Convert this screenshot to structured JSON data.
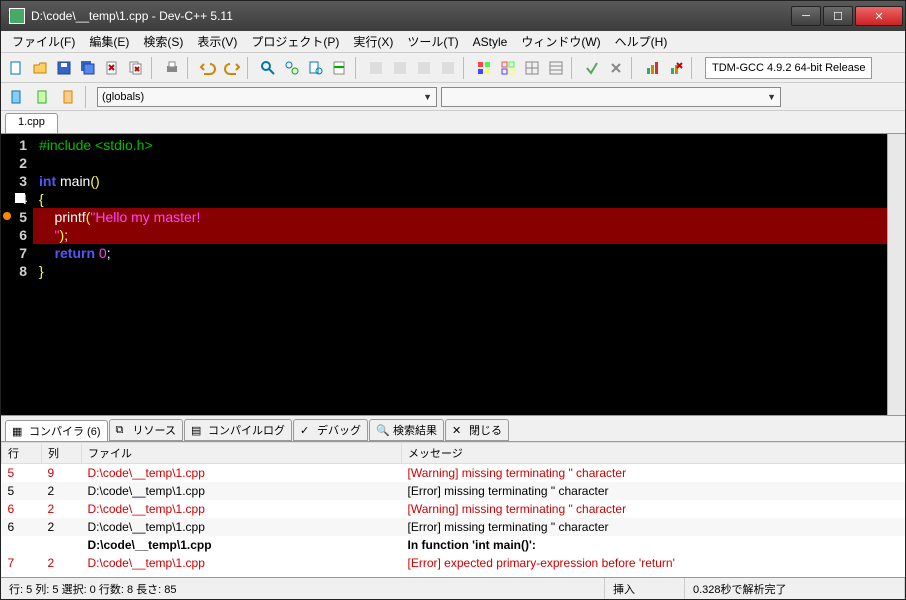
{
  "window": {
    "title": "D:\\code\\__temp\\1.cpp - Dev-C++ 5.11"
  },
  "menus": [
    "ファイル(F)",
    "編集(E)",
    "検索(S)",
    "表示(V)",
    "プロジェクト(P)",
    "実行(X)",
    "ツール(T)",
    "AStyle",
    "ウィンドウ(W)",
    "ヘルプ(H)"
  ],
  "compiler_selector": "TDM-GCC 4.9.2 64-bit Release",
  "scope_dd": "(globals)",
  "member_dd": "",
  "file_tab": "1.cpp",
  "code": {
    "lines": [
      {
        "n": 1,
        "seg": [
          {
            "t": "#include <stdio.h>",
            "c": "c-pre"
          }
        ]
      },
      {
        "n": 2,
        "seg": []
      },
      {
        "n": 3,
        "seg": [
          {
            "t": "int",
            "c": "c-kw"
          },
          {
            "t": " main",
            "c": "c-fn"
          },
          {
            "t": "()",
            "c": "c-br"
          }
        ]
      },
      {
        "n": 4,
        "cur": true,
        "seg": [
          {
            "t": "{",
            "c": "c-br"
          }
        ]
      },
      {
        "n": 5,
        "bp": true,
        "hl": true,
        "seg": [
          {
            "t": "    printf",
            "c": "c-fn"
          },
          {
            "t": "(",
            "c": "c-br"
          },
          {
            "t": "\"Hello my master!",
            "c": "c-str"
          }
        ]
      },
      {
        "n": 6,
        "hl": true,
        "seg": [
          {
            "t": "    \"",
            "c": "c-str"
          },
          {
            "t": ")",
            "c": "c-br"
          },
          {
            "t": ";",
            "c": "c-pl"
          }
        ]
      },
      {
        "n": 7,
        "seg": [
          {
            "t": "    ",
            "c": "c-pl"
          },
          {
            "t": "return",
            "c": "c-kw"
          },
          {
            "t": " ",
            "c": "c-pl"
          },
          {
            "t": "0",
            "c": "c-num"
          },
          {
            "t": ";",
            "c": "c-pl"
          }
        ]
      },
      {
        "n": 8,
        "seg": [
          {
            "t": "}",
            "c": "c-br"
          }
        ]
      }
    ]
  },
  "bottom_tabs": [
    {
      "label": "コンパイラ (6)",
      "active": true
    },
    {
      "label": "リソース"
    },
    {
      "label": "コンパイルログ"
    },
    {
      "label": "デバッグ"
    },
    {
      "label": "検索結果"
    },
    {
      "label": "閉じる"
    }
  ],
  "msg_headers": {
    "line": "行",
    "col": "列",
    "file": "ファイル",
    "msg": "メッセージ"
  },
  "messages": [
    {
      "line": "5",
      "col": "9",
      "file": "D:\\code\\__temp\\1.cpp",
      "msg": "[Warning] missing terminating \" character",
      "cls": "err"
    },
    {
      "line": "5",
      "col": "2",
      "file": "D:\\code\\__temp\\1.cpp",
      "msg": "[Error] missing terminating \" character",
      "cls": "bk"
    },
    {
      "line": "6",
      "col": "2",
      "file": "D:\\code\\__temp\\1.cpp",
      "msg": "[Warning] missing terminating \" character",
      "cls": "err"
    },
    {
      "line": "6",
      "col": "2",
      "file": "D:\\code\\__temp\\1.cpp",
      "msg": "[Error] missing terminating \" character",
      "cls": "bk"
    },
    {
      "line": "",
      "col": "",
      "file": "D:\\code\\__temp\\1.cpp",
      "msg": "In function 'int main()':",
      "cls": "bold"
    },
    {
      "line": "7",
      "col": "2",
      "file": "D:\\code\\__temp\\1.cpp",
      "msg": "[Error] expected primary-expression before 'return'",
      "cls": "err"
    }
  ],
  "status": {
    "pos": "行:   5   列:   5   選択:   0   行数:   8   長さ:   85",
    "ins": "挿入",
    "done": "0.328秒で解析完了"
  }
}
